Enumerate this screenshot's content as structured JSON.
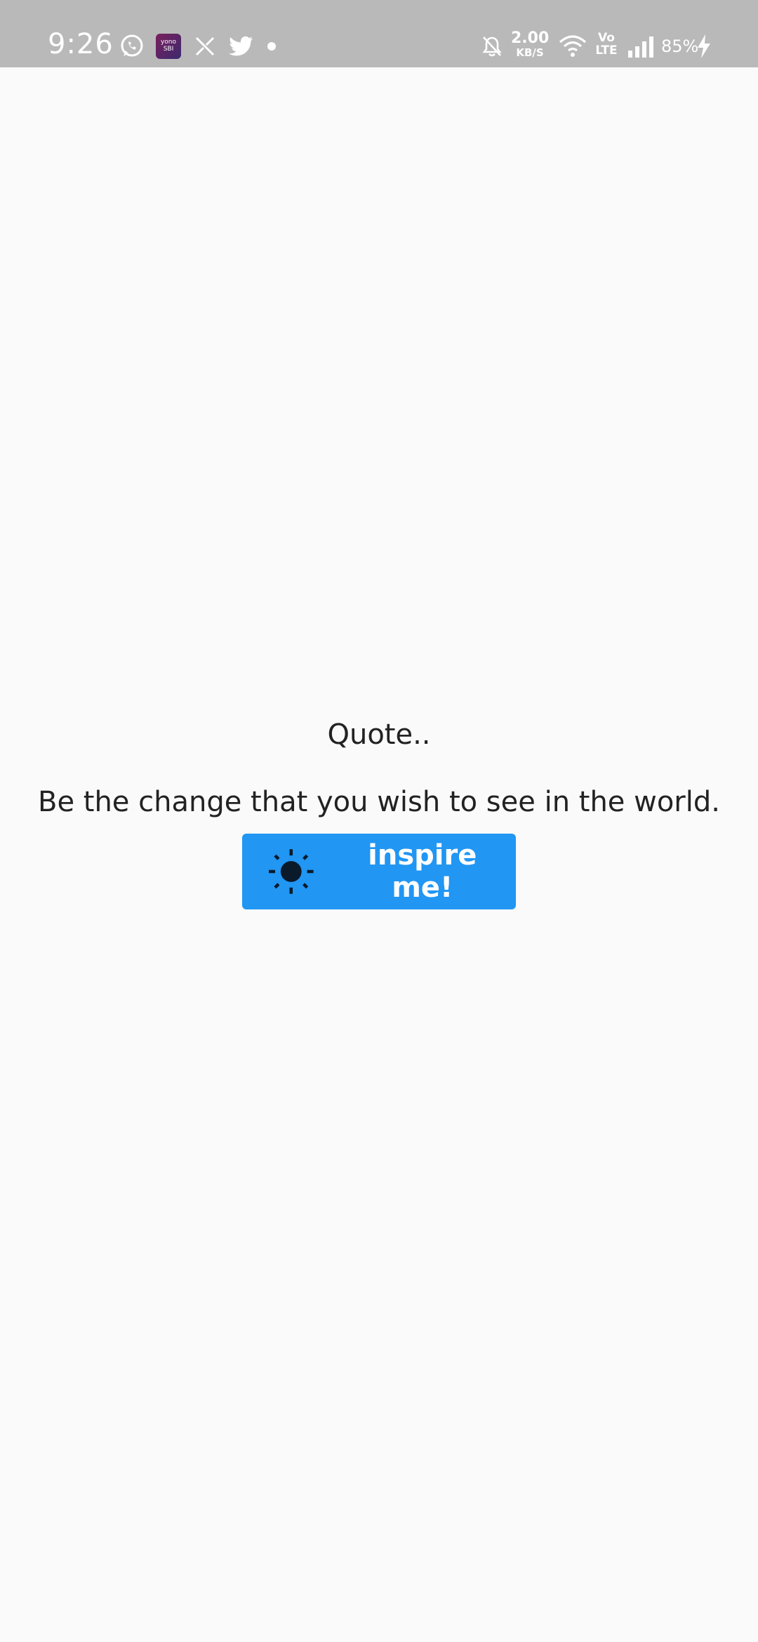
{
  "status_bar": {
    "time": "9:26",
    "app_icon_label": "yono SBI",
    "net_speed_value": "2.00",
    "net_speed_unit": "KB/S",
    "volte_top": "Vo",
    "volte_bottom": "LTE",
    "battery": "85%",
    "icons": [
      "whatsapp-icon",
      "yono-sbi-icon",
      "x-app-icon",
      "twitter-icon",
      "notification-dot-icon",
      "bell-off-icon",
      "wifi-icon",
      "signal-icon",
      "charging-icon"
    ]
  },
  "main": {
    "title": "Quote..",
    "quote": "Be the change that you wish to see in the world.",
    "button_label": "inspire me!",
    "button_icon": "sun-icon"
  },
  "colors": {
    "status_bar_bg": "#b9b9b9",
    "page_bg": "#fafafa",
    "button_bg": "#2196f3",
    "text": "#222222"
  }
}
